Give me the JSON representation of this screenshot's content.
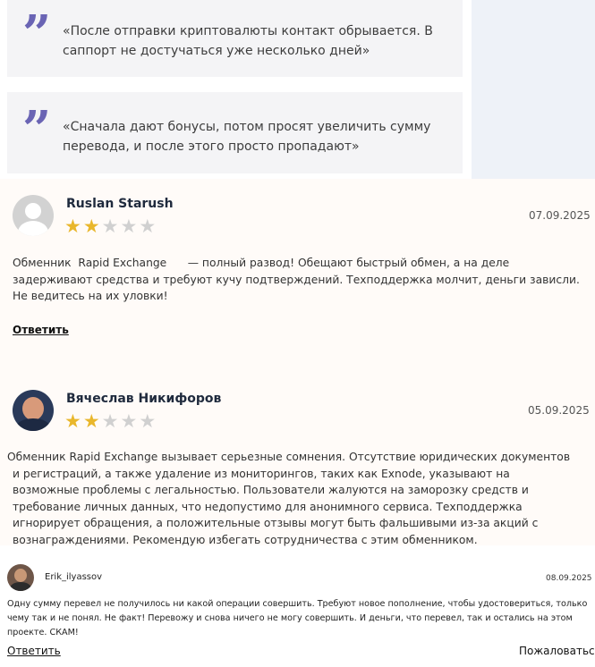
{
  "quotes": [
    {
      "icon": "quote-icon",
      "text": "«После отправки криптовалюты контакт обрывается. В саппорт не достучаться уже несколько дней»"
    },
    {
      "icon": "quote-icon",
      "text": "«Сначала дают бонусы, потом просят увеличить сумму перевода, и после этого просто пропадают»"
    }
  ],
  "reviews": [
    {
      "author": "Ruslan Starush",
      "date": "07.09.2025",
      "rating": 2,
      "max_rating": 5,
      "text": "Обменник  Rapid Exchange      — полный развод! Обещают быстрый обмен, а на деле задерживают средства и требуют кучу подтверждений. Техподдержка молчит, деньги зависли. Не ведитесь на их уловки!",
      "reply_label": "Ответить"
    },
    {
      "author": "Вячеслав Никифоров",
      "date": "05.09.2025",
      "rating": 2,
      "max_rating": 5,
      "text": "Обменник Rapid Exchange вызывает серьезные сомнения. Отсутствие юридических документов и регистраций, а также удаление из мониторингов, таких как Exnode, указывают на возможные проблемы с легальностью. Пользователи жалуются на заморозку средств и требование личных данных, что недопустимо для анонимного сервиса. Техподдержка игнорирует обращения, а положительные отзывы могут быть фальшивыми из-за акций с вознаграждениями. Рекомендую избегать сотрудничества с этим обменником."
    },
    {
      "author": "Erik_ilyassov",
      "date": "08.09.2025",
      "text": "Одну сумму перевел не получилось ни какой операции совершить. Требуют новое пополнение, чтобы удостовериться, только чему так и не понял. Не факт! Перевожу и снова ничего не могу совершить. И деньги, что перевел, так и остались на этом проекте. СКАМ!",
      "reply_label": "Ответить",
      "complain_label": "Пожаловаться"
    }
  ],
  "colors": {
    "quote_mark": "#6a64b4",
    "star_on": "#e9b72c",
    "star_off": "#d0d0d0",
    "review_bg": "#fffbf8",
    "quote_bg": "#f4f4f6",
    "side_panel": "#eef2f8"
  }
}
